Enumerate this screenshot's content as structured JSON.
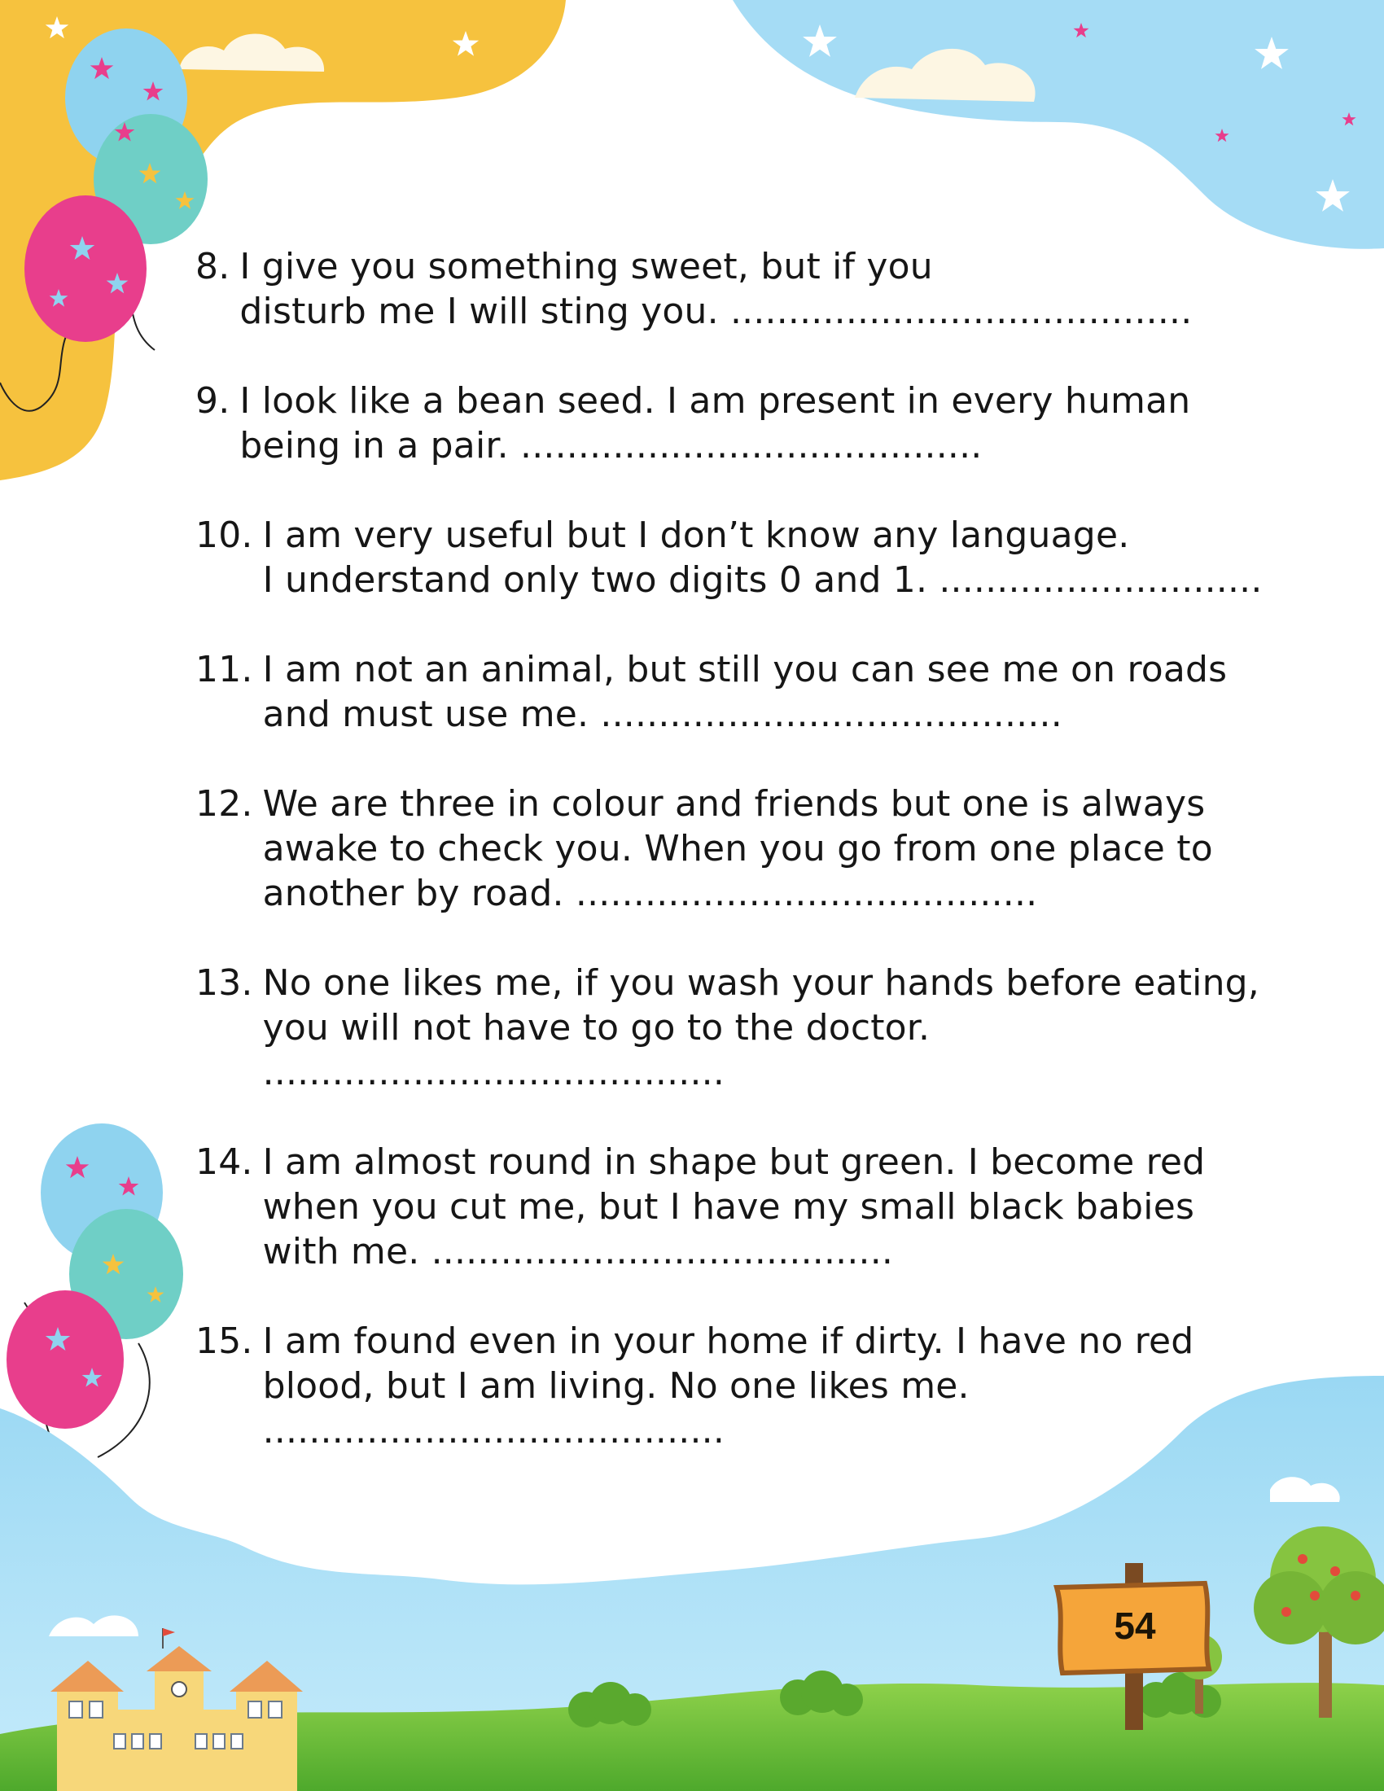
{
  "riddles": [
    {
      "number": "8.",
      "lines": [
        "I give you something sweet, but if you",
        "disturb me I will sting you. ........................................"
      ]
    },
    {
      "number": "9.",
      "lines": [
        "I look like a bean seed. I am present in every human",
        "being in a pair. ........................................"
      ]
    },
    {
      "number": "10.",
      "lines": [
        "I am very useful but I don’t know any language.",
        "I understand only two digits 0 and 1. ............................"
      ]
    },
    {
      "number": "11.",
      "lines": [
        "I am not an animal, but still you can see me on roads",
        "and must use me. ........................................"
      ]
    },
    {
      "number": "12.",
      "lines": [
        "We are three in colour and friends but one is always",
        "awake to check you. When you go from one place to",
        "another by road. ........................................"
      ]
    },
    {
      "number": "13.",
      "lines": [
        "No one likes me, if you wash your hands before eating,",
        "you will not have to go to the doctor.",
        "........................................"
      ]
    },
    {
      "number": "14.",
      "lines": [
        "I am almost round in shape but green. I become red",
        "when you cut me, but I have my small black babies",
        "with me. ........................................"
      ]
    },
    {
      "number": "15.",
      "lines": [
        "I am found even in your home if dirty. I have no red",
        "blood, but I am living. No one likes me.",
        "........................................"
      ]
    }
  ],
  "page_number": "54",
  "colors": {
    "yellow_corner": "#f6c23e",
    "sky_blue": "#a5dcf5",
    "grass_green": "#6cbf3a",
    "balloon_pink": "#e83e8c",
    "balloon_blue": "#8fd3ef",
    "balloon_teal": "#6fcfc6",
    "sign_orange": "#f5a53a"
  }
}
